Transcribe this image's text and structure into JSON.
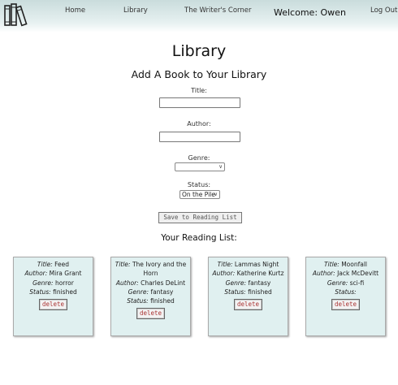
{
  "nav": {
    "home": "Home",
    "library": "Library",
    "writers_corner": "The Writer's Corner",
    "welcome": "Welcome: Owen",
    "logout": "Log Out"
  },
  "page_title": "Library",
  "form": {
    "heading": "Add A Book to Your Library",
    "title_label": "Title:",
    "title_value": "",
    "author_label": "Author:",
    "author_value": "",
    "genre_label": "Genre:",
    "genre_value": "",
    "status_label": "Status:",
    "status_value": "On the Pile",
    "save_label": "Save to Reading List"
  },
  "reading_list": {
    "heading": "Your Reading List:",
    "labels": {
      "title": "Title:",
      "author": "Author:",
      "genre": "Genre:",
      "status": "Status:"
    },
    "delete_label": "delete",
    "books": [
      {
        "title": "Feed",
        "author": "Mira Grant",
        "genre": "horror",
        "status": "finished"
      },
      {
        "title": "The Ivory and the Horn",
        "author": "Charles DeLint",
        "genre": "fantasy",
        "status": "finished"
      },
      {
        "title": "Lammas Night",
        "author": "Katherine Kurtz",
        "genre": "fantasy",
        "status": "finished"
      },
      {
        "title": "Moonfall",
        "author": "Jack McDevitt",
        "genre": "sci-fi",
        "status": ""
      }
    ]
  },
  "colors": {
    "card_bg": "#e0f0f0",
    "nav_bg": "#c9dcdc",
    "delete_text": "#a33333"
  },
  "icons": {
    "logo": "books-icon",
    "dropdown": "chevron-down-icon"
  }
}
